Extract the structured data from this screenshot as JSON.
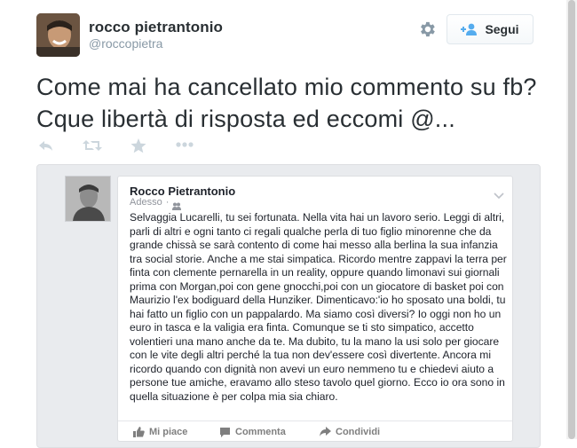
{
  "tweet": {
    "author_name": "rocco pietrantonio",
    "author_handle": "@roccopietra",
    "follow_label": "Segui",
    "text": "Come mai ha cancellato mio commento su fb? Cque libertà di risposta ed eccomi @...",
    "actions": [
      "reply-icon",
      "retweet-icon",
      "favorite-icon",
      "more-icon"
    ]
  },
  "embedded_post": {
    "author": "Rocco Pietrantonio",
    "time": "Adesso",
    "body": "Selvaggia Lucarelli, tu sei fortunata. Nella vita hai un lavoro serio. Leggi di altri, parli di altri e ogni tanto ci regali qualche perla di tuo figlio minorenne che da grande chissà se sarà contento di come hai messo alla berlina la sua infanzia tra social storie. Anche a me stai simpatica. Ricordo mentre zappavi la terra per finta con clemente pernarella in un reality, oppure quando limonavi sui giornali prima con Morgan,poi con gene gnocchi,poi con un giocatore di basket poi con Maurizio l'ex bodiguard della Hunziker. Dimenticavo:'io ho sposato una boldi, tu hai fatto un figlio con un pappalardo. Ma siamo così diversi? Io oggi non ho un euro in tasca e la valigia era finta. Comunque se ti sto simpatico, accetto volentieri una mano anche da te. Ma dubito, tu la mano la usi solo per giocare con le vite degli altri perché la tua non dev'essere così divertente. Ancora mi ricordo quando con dignità non avevi un euro nemmeno tu e chiedevi aiuto a persone tue amiche, eravamo allo steso tavolo quel giorno. Ecco io ora sono in quella situazione è per colpa mia sia chiaro.",
    "like_label": "Mi piace",
    "comment_label": "Commenta",
    "share_label": "Condividi"
  },
  "colors": {
    "text": "#292f33",
    "muted": "#8899a6",
    "follow_icon": "#55acee",
    "fb_gray": "#7f7f7f"
  }
}
